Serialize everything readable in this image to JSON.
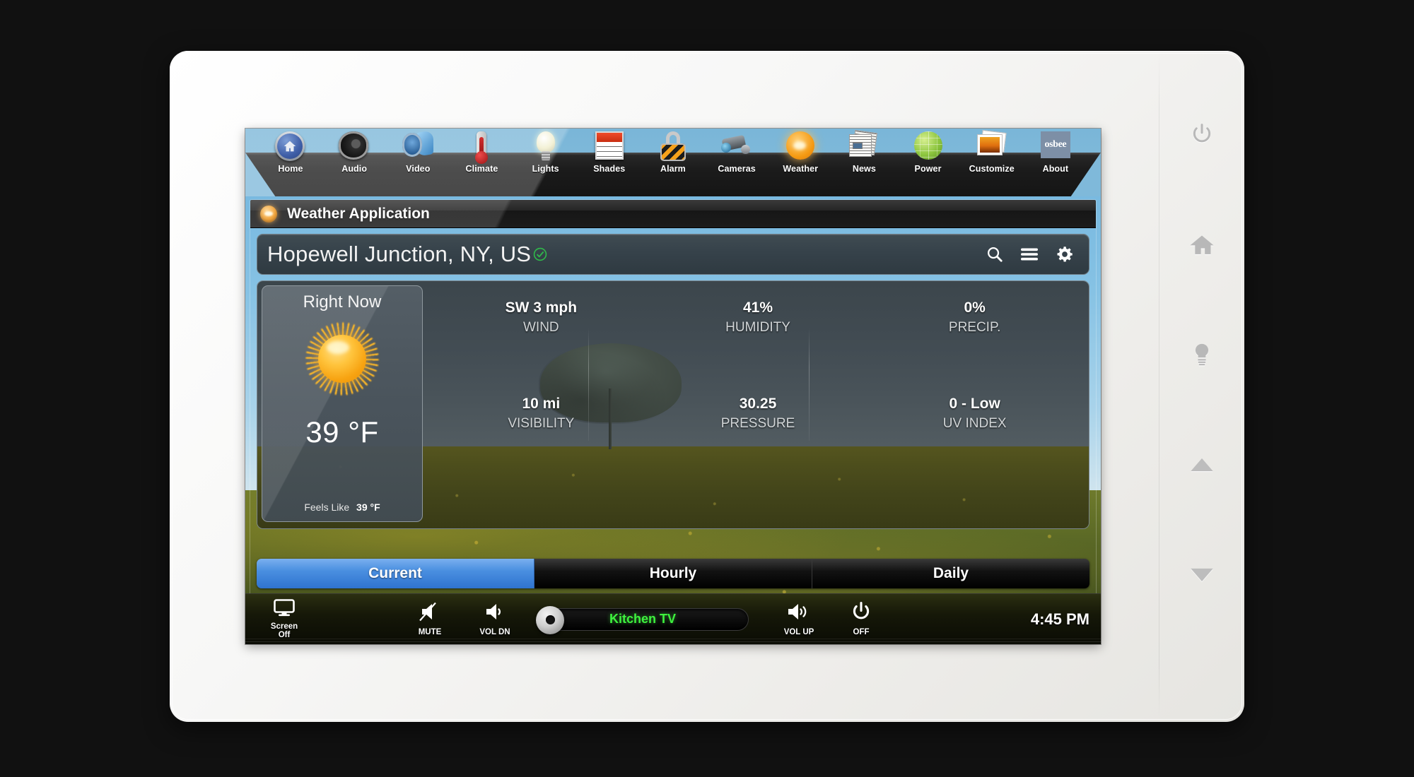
{
  "nav": {
    "items": [
      {
        "label": "Home",
        "icon": "home-icon"
      },
      {
        "label": "Audio",
        "icon": "speaker-icon"
      },
      {
        "label": "Video",
        "icon": "video-reel-icon"
      },
      {
        "label": "Climate",
        "icon": "thermometer-icon"
      },
      {
        "label": "Lights",
        "icon": "lightbulb-icon"
      },
      {
        "label": "Shades",
        "icon": "window-shade-icon"
      },
      {
        "label": "Alarm",
        "icon": "padlock-icon"
      },
      {
        "label": "Cameras",
        "icon": "security-camera-icon"
      },
      {
        "label": "Weather",
        "icon": "sun-icon"
      },
      {
        "label": "News",
        "icon": "newspaper-icon"
      },
      {
        "label": "Power",
        "icon": "globe-icon"
      },
      {
        "label": "Customize",
        "icon": "photos-icon"
      },
      {
        "label": "About",
        "icon": "osbee-logo-icon"
      }
    ]
  },
  "app": {
    "title": "Weather Application",
    "title_icon": "sun-icon"
  },
  "search": {
    "location": "Hopewell Junction, NY, US",
    "verified_icon": "green-check-circle-icon",
    "search_icon": "search-icon",
    "menu_icon": "hamburger-menu-icon",
    "settings_icon": "gear-icon"
  },
  "right_now": {
    "title": "Right Now",
    "condition_icon": "sunny-icon",
    "temperature": "39 °F",
    "feels_like_label": "Feels Like",
    "feels_like_value": "39 °F"
  },
  "stats": [
    {
      "value": "SW 3 mph",
      "label": "WIND"
    },
    {
      "value": "41%",
      "label": "HUMIDITY"
    },
    {
      "value": "0%",
      "label": "PRECIP."
    },
    {
      "value": "10 mi",
      "label": "VISIBILITY"
    },
    {
      "value": "30.25",
      "label": "PRESSURE"
    },
    {
      "value": "0 - Low",
      "label": "UV INDEX"
    }
  ],
  "tabs": [
    {
      "label": "Current",
      "active": true
    },
    {
      "label": "Hourly",
      "active": false
    },
    {
      "label": "Daily",
      "active": false
    }
  ],
  "dock": {
    "screen_off_line1": "Screen",
    "screen_off_line2": "Off",
    "mute_label": "MUTE",
    "vol_dn_label": "VOL DN",
    "vol_up_label": "VOL UP",
    "off_label": "OFF",
    "slider_label": "Kitchen TV",
    "clock": "4:45 PM"
  },
  "hardware_buttons": [
    {
      "icon": "power-icon"
    },
    {
      "icon": "home-icon"
    },
    {
      "icon": "lightbulb-icon"
    },
    {
      "icon": "up-arrow-icon"
    },
    {
      "icon": "down-arrow-icon"
    }
  ],
  "colors": {
    "accent_blue": "#4a8fe0",
    "sky_blue": "#7fb9da",
    "slider_green": "#3ef23e",
    "verified_green": "#2fb84a"
  }
}
